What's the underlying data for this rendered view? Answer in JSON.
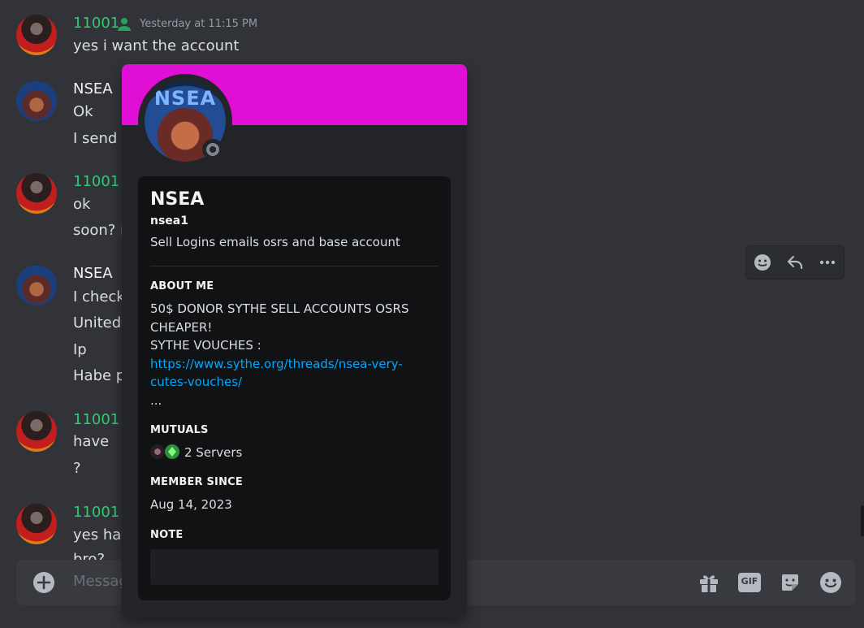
{
  "messages": [
    {
      "username": "11001",
      "timestamp": "Yesterday at 11:15 PM",
      "lines": [
        "yes i want the account"
      ]
    },
    {
      "username": "NSEA",
      "lines": [
        "Ok",
        "I send s"
      ]
    },
    {
      "username": "11001",
      "lines": [
        "ok",
        "soon? n"
      ]
    },
    {
      "username": "NSEA",
      "lines": [
        "I check",
        "United",
        "Ip",
        "Habe p"
      ]
    },
    {
      "username": "11001",
      "lines": [
        "have",
        "?"
      ]
    },
    {
      "username": "11001",
      "lines": [
        "yes hav",
        "bro?"
      ]
    }
  ],
  "composer": {
    "placeholder": "Messag"
  },
  "icons": {
    "role": "person-icon",
    "add": "plus-circle-icon",
    "gift": "gift-icon",
    "gif": "gif-icon",
    "sticker": "sticker-icon",
    "emoji": "emoji-icon",
    "react": "add-reaction-icon",
    "reply": "reply-icon",
    "more": "more-icon"
  },
  "labels": {
    "gif": "GIF"
  },
  "colors": {
    "background": "#313338",
    "green_username": "#2ecc71",
    "banner": "#df0fd5",
    "link": "#00a8fc",
    "status_offline": "#80848e"
  },
  "profile": {
    "avatar_text": "NSEA",
    "display_name": "NSEA",
    "username": "nsea1",
    "custom_status": "Sell Logins emails osrs and base account",
    "about_heading": "ABOUT ME",
    "about_lines": [
      "50$ DONOR SYTHE  SELL ACCOUNTS OSRS",
      "CHEAPER!",
      "SYTHE VOUCHES :"
    ],
    "about_link": [
      "https://www.sythe.org/threads/nsea-very-",
      "cutes-vouches/"
    ],
    "about_more": "...",
    "mutuals_heading": "MUTUALS",
    "mutuals_text": "2 Servers",
    "member_since_heading": "MEMBER SINCE",
    "member_since": "Aug 14, 2023",
    "note_heading": "NOTE"
  }
}
